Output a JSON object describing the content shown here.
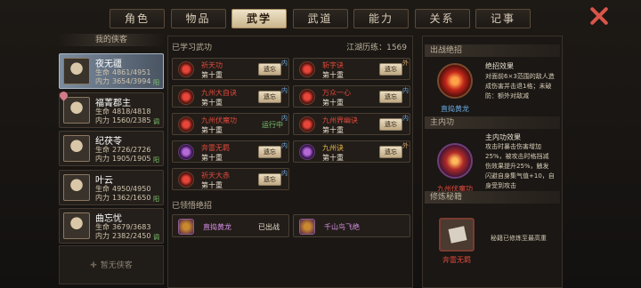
{
  "tabs": [
    {
      "label": "角色",
      "active": false,
      "dot": false
    },
    {
      "label": "物品",
      "active": false,
      "dot": true
    },
    {
      "label": "武学",
      "active": true,
      "dot": false
    },
    {
      "label": "武道",
      "active": false,
      "dot": false
    },
    {
      "label": "能力",
      "active": false,
      "dot": false
    },
    {
      "label": "关系",
      "active": false,
      "dot": false
    },
    {
      "label": "记事",
      "active": false,
      "dot": false
    }
  ],
  "left": {
    "title": "我的侠客",
    "characters": [
      {
        "name": "夜无疆",
        "hp_label": "生命",
        "hp": "4861/4951",
        "mp_label": "内力",
        "mp": "3654/3994",
        "tag": "阳",
        "selected": true,
        "heart": false
      },
      {
        "name": "福菁郡主",
        "hp_label": "生命",
        "hp": "4818/4818",
        "mp_label": "内力",
        "mp": "1560/2385",
        "tag": "调",
        "selected": false,
        "heart": true
      },
      {
        "name": "纪茯苓",
        "hp_label": "生命",
        "hp": "2726/2726",
        "mp_label": "内力",
        "mp": "1905/1905",
        "tag": "阳",
        "selected": false,
        "heart": false
      },
      {
        "name": "叶云",
        "hp_label": "生命",
        "hp": "4950/4950",
        "mp_label": "内力",
        "mp": "1362/1650",
        "tag": "阳",
        "selected": false,
        "heart": false
      },
      {
        "name": "曲忘忧",
        "hp_label": "生命",
        "hp": "3679/3683",
        "mp_label": "内力",
        "mp": "2382/2450",
        "tag": "调",
        "selected": false,
        "heart": false
      }
    ],
    "empty_label": "暂无侠客"
  },
  "middle": {
    "learned_title": "已学习武功",
    "exp_label": "江湖历练：1569",
    "skills": [
      {
        "name": "祈天功",
        "level": "第十重",
        "action": "遗忘",
        "badge": "内",
        "badge_kind": "blue",
        "name_color": "r",
        "icon": "red"
      },
      {
        "name": "斩字诀",
        "level": "第十重",
        "action": "遗忘",
        "badge": "外",
        "badge_kind": "orange",
        "name_color": "r",
        "icon": "red"
      },
      {
        "name": "九州大自诀",
        "level": "第十重",
        "action": "遗忘",
        "badge": "内",
        "badge_kind": "blue",
        "name_color": "r",
        "icon": "red"
      },
      {
        "name": "万众一心",
        "level": "第十重",
        "action": "遗忘",
        "badge": "内",
        "badge_kind": "blue",
        "name_color": "r",
        "icon": "red"
      },
      {
        "name": "九州伏魔功",
        "level": "第十重",
        "action": "运行中",
        "badge": "内",
        "badge_kind": "blue",
        "name_color": "r",
        "icon": "red"
      },
      {
        "name": "九州界幽诀",
        "level": "第十重",
        "action": "遗忘",
        "badge": "内",
        "badge_kind": "blue",
        "name_color": "r",
        "icon": "red"
      },
      {
        "name": "奔雷无羁",
        "level": "第十重",
        "action": "遗忘",
        "badge": "内",
        "badge_kind": "blue",
        "name_color": "r",
        "icon": "pur"
      },
      {
        "name": "九州诀",
        "level": "第十重",
        "action": "遗忘",
        "badge": "外",
        "badge_kind": "orange",
        "name_color": "y",
        "icon": "pur"
      },
      {
        "name": "祈天大赤",
        "level": "第十重",
        "action": "遗忘",
        "badge": "内",
        "badge_kind": "blue",
        "name_color": "r",
        "icon": "red"
      }
    ],
    "ult_title": "已领悟绝招",
    "ults": [
      {
        "name": "直捣黄龙",
        "state": "已出战"
      },
      {
        "name": "千山鸟飞绝",
        "state": ""
      }
    ]
  },
  "right": {
    "battle_title": "出战绝招",
    "battle_name": "直捣黄龙",
    "battle_effect_title": "绝招效果",
    "battle_effect_text": "对面前6×3范围的敌人造成伤害并击退1格；未破防：额外对敌减",
    "inner_title": "主内功",
    "inner_name": "九州伏魔功",
    "inner_effect_title": "主内功效果",
    "inner_effect_text": "攻击时暴击伤害增加25%，被攻击时格挡减伤效果提升25%，触发闪避自身集气值+10，自身受到攻击",
    "cultivate_title": "修炼秘籍",
    "cultivate_name": "奔雷无羁",
    "cultivate_note": "秘籍已修炼至最高重"
  }
}
